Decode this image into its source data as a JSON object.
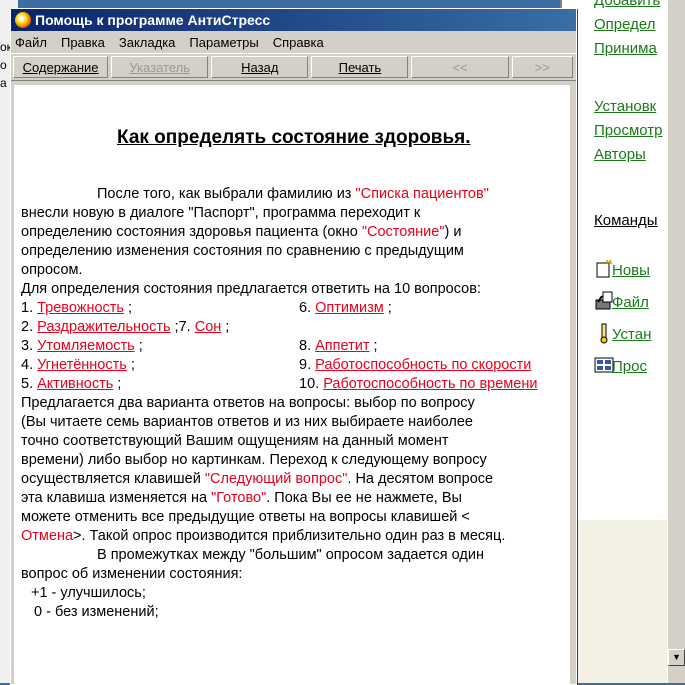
{
  "help_window": {
    "title": "Помощь к программе АнтиСтресс",
    "menu": [
      "Файл",
      "Правка",
      "Закладка",
      "Параметры",
      "Справка"
    ],
    "toolbar": {
      "contents": "Содержание",
      "index": "Указатель",
      "back": "Назад",
      "print": "Печать",
      "prev": "<<",
      "next": ">>"
    },
    "heading": "Как определять состояние здоровья",
    "heading_dot": ".",
    "lines": {
      "l1a": "После того, как выбрали фамилию из ",
      "l1b": "\"Списка пациентов\"",
      "l2": "внесли новую в диалоге \"Паспорт\", программа переходит к",
      "l3a": "определению состояния здоровья пациента (окно ",
      "l3b": "\"Состояние\"",
      "l3c": ") и",
      "l4": "определению изменения состояния по сравнению с предыдущим",
      "l5": "опросом.",
      "l6": " Для определения состояния предлагается ответить на 10 вопросов:",
      "q1n": "1. ",
      "q1": "Тревожность",
      "q1s": " ;",
      "q6n": "6. ",
      "q6": "Оптимизм",
      "q6s": " ;",
      "q2n": "2. ",
      "q2": "Раздражительность",
      "q2s": " ;",
      "q7n": "7. ",
      "q7": "Сон",
      "q7s": " ;",
      "q3n": "3. ",
      "q3": "Утомляемость",
      "q3s": " ;",
      "q8n": "8. ",
      "q8": "Аппетит",
      "q8s": " ;",
      "q4n": "4. ",
      "q4": "Угнетённость",
      "q4s": " ;",
      "q9n": "9. ",
      "q9": "Работоспособность по скорости",
      "q5n": "5. ",
      "q5": "Активность",
      "q5s": " ;",
      "q10n": "10. ",
      "q10": "Работоспособность по времени",
      "p1": "Предлагается два варианта ответов на вопросы: выбор по вопросу",
      "p2": "(Вы читаете семь вариантов ответов и из них выбираете наиболее",
      "p3": "точно соответствующий Вашим ощущениям на данный момент",
      "p4": "времени) либо выбор но картинкам. Переход к следующему вопросу",
      "p5a": "осуществляется клавишей ",
      "p5b": "\"Следующий вопрос\"",
      "p5c": ". На десятом вопросе",
      "p6a": "эта клавиша изменяется на ",
      "p6b": "\"Готово\"",
      "p6c": ". Пока Вы ее не нажмете, Вы",
      "p7": "можете отменить все предыдущие ответы на вопросы клавишей <",
      "p8a": "Отмена",
      "p8b": ">. Такой опрос производится приблизительно один раз в месяц.",
      "p9": "В промежутках между \"большим\" опросом задается один",
      "p10": "вопрос об изменении состояния:",
      "p11": "+1 - улучшилось;",
      "p12": "0 - без изменений;"
    }
  },
  "background_window": {
    "links_top": [
      "Добавить",
      "Определ",
      "Принима"
    ],
    "links_mid": [
      "Установк",
      "Просмотр",
      "Авторы"
    ],
    "commands": "Команды",
    "icon_links": [
      "Новы",
      "Файл",
      "Устан",
      "Прос"
    ]
  },
  "left_strip": [
    "ок",
    "о",
    "а"
  ]
}
